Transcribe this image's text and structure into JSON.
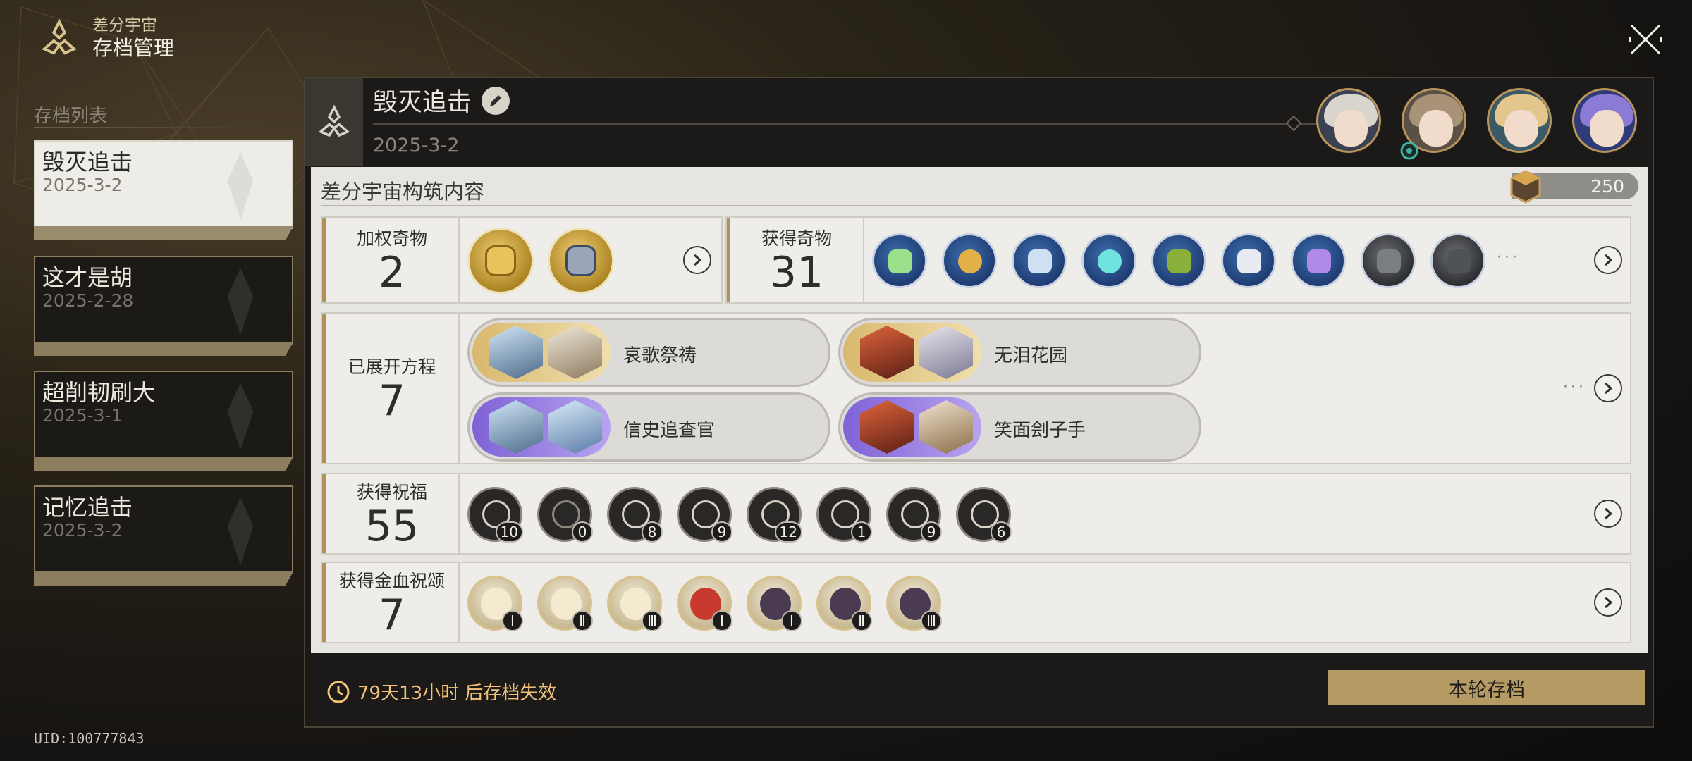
{
  "header": {
    "mode": "差分宇宙",
    "title": "存档管理"
  },
  "save_list": {
    "label": "存档列表",
    "items": [
      {
        "name": "毁灭追击",
        "date": "2025-3-2",
        "active": true
      },
      {
        "name": "这才是胡",
        "date": "2025-2-28",
        "active": false
      },
      {
        "name": "超削韧刷大",
        "date": "2025-3-1",
        "active": false
      },
      {
        "name": "记忆追击",
        "date": "2025-3-2",
        "active": false
      }
    ]
  },
  "uid": "UID:100777843",
  "panel": {
    "title": "毁灭追击",
    "date": "2025-3-2",
    "avatars": [
      {
        "hair": "#d9d4cc"
      },
      {
        "hair": "#a89278"
      },
      {
        "hair": "#e2c68b"
      },
      {
        "hair": "#8b7ad6"
      }
    ]
  },
  "content": {
    "title": "差分宇宙构筑内容",
    "currency": "250",
    "weighted_curio": {
      "label": "加权奇物",
      "count": "2"
    },
    "curios": {
      "label": "获得奇物",
      "count": "31"
    },
    "equations": {
      "label": "已展开方程",
      "count": "7",
      "items": [
        {
          "name": "哀歌祭祷",
          "tier": "gold"
        },
        {
          "name": "无泪花园",
          "tier": "gold"
        },
        {
          "name": "信史追查官",
          "tier": "purple"
        },
        {
          "name": "笑面刽子手",
          "tier": "purple"
        }
      ]
    },
    "blessings": {
      "label": "获得祝福",
      "count": "55",
      "items": [
        "10",
        "0",
        "8",
        "9",
        "12",
        "1",
        "9",
        "6"
      ]
    },
    "golden_blood": {
      "label": "获得金血祝颂",
      "count": "7",
      "items": [
        "Ⅰ",
        "Ⅱ",
        "Ⅲ",
        "Ⅰ",
        "Ⅰ",
        "Ⅱ",
        "Ⅲ"
      ]
    }
  },
  "footer": {
    "timer": "79天13小时 后存档失效",
    "button": "本轮存档"
  },
  "colors": {
    "accent_gold": "#b69a64",
    "timer": "#f2c27a"
  }
}
